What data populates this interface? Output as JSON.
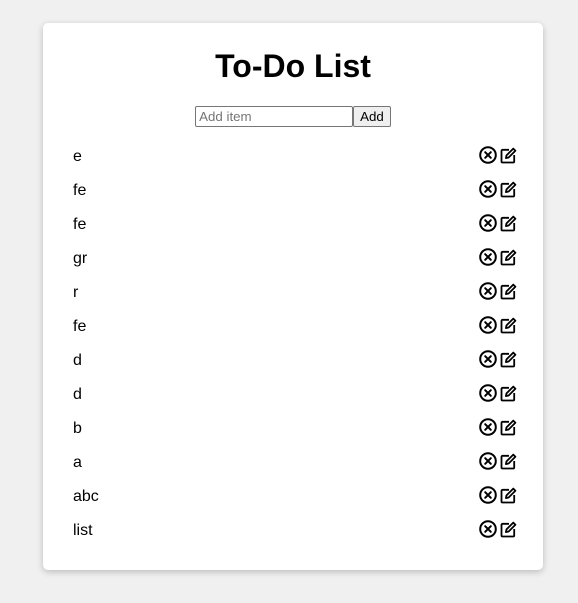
{
  "header": {
    "title": "To-Do List"
  },
  "add": {
    "placeholder": "Add item",
    "button_label": "Add"
  },
  "items": [
    {
      "label": "e"
    },
    {
      "label": "fe"
    },
    {
      "label": "fe"
    },
    {
      "label": "gr"
    },
    {
      "label": "r"
    },
    {
      "label": "fe"
    },
    {
      "label": "d"
    },
    {
      "label": "d"
    },
    {
      "label": "b"
    },
    {
      "label": "a"
    },
    {
      "label": "abc"
    },
    {
      "label": "list"
    }
  ],
  "icons": {
    "delete": "close-circle-icon",
    "edit": "edit-icon"
  }
}
